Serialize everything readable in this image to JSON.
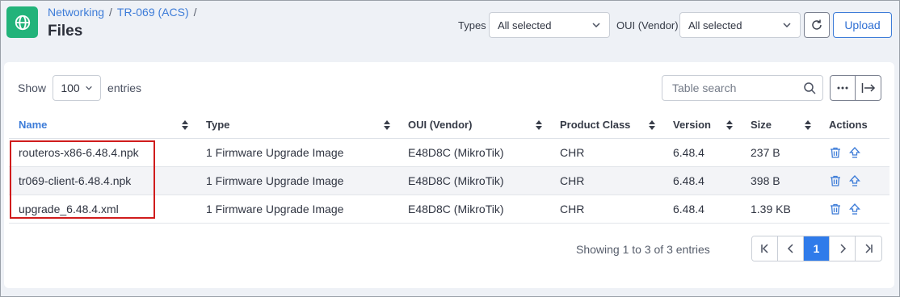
{
  "breadcrumb": {
    "items": [
      "Networking",
      "TR-069 (ACS)"
    ],
    "separator": "/"
  },
  "page": {
    "title": "Files",
    "icon": "globe-icon"
  },
  "filters": {
    "types_label": "Types",
    "types_value": "All selected",
    "oui_label": "OUI (Vendor)",
    "oui_value": "All selected",
    "refresh_icon": "refresh-icon",
    "upload_label": "Upload"
  },
  "entries": {
    "show_label": "Show",
    "page_size": "100",
    "entries_label": "entries"
  },
  "search": {
    "placeholder": "Table search"
  },
  "table": {
    "columns": [
      "Name",
      "Type",
      "OUI (Vendor)",
      "Product Class",
      "Version",
      "Size",
      "Actions"
    ],
    "rows": [
      [
        "routeros-x86-6.48.4.npk",
        "1 Firmware Upgrade Image",
        "E48D8C (MikroTik)",
        "CHR",
        "6.48.4",
        "237 B"
      ],
      [
        "tr069-client-6.48.4.npk",
        "1 Firmware Upgrade Image",
        "E48D8C (MikroTik)",
        "CHR",
        "6.48.4",
        "398 B"
      ],
      [
        "upgrade_6.48.4.xml",
        "1 Firmware Upgrade Image",
        "E48D8C (MikroTik)",
        "CHR",
        "6.48.4",
        "1.39 KB"
      ]
    ]
  },
  "footer": {
    "showing": "Showing 1 to 3 of 3 entries",
    "current_page": "1"
  },
  "colors": {
    "accent": "#2f7bea",
    "brand": "#22b37a",
    "highlight": "#d01c1c",
    "delete": "#3d7cd8"
  }
}
